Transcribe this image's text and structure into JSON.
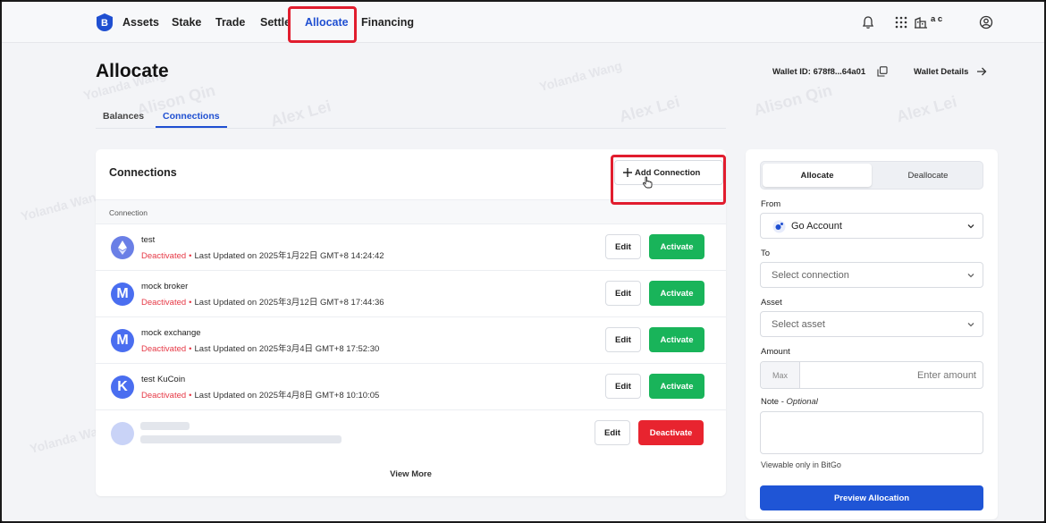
{
  "nav": {
    "items": [
      {
        "label": "Assets"
      },
      {
        "label": "Stake"
      },
      {
        "label": "Trade"
      },
      {
        "label": "Settle"
      },
      {
        "label": "Allocate"
      },
      {
        "label": "Financing"
      }
    ],
    "active": "Allocate",
    "org": "a c"
  },
  "page": {
    "title": "Allocate",
    "wallet_id": "Wallet ID: 678f8...64a01",
    "wallet_details": "Wallet Details"
  },
  "tabs": [
    {
      "label": "Balances"
    },
    {
      "label": "Connections"
    }
  ],
  "connections": {
    "title": "Connections",
    "add_label": "Add Connection",
    "column_header": "Connection",
    "edit_label": "Edit",
    "activate_label": "Activate",
    "deactivate_label": "Deactivate",
    "separator": "•",
    "rows": [
      {
        "initial": "",
        "icon": "ethereum-icon",
        "name": "test",
        "status": "Deactivated",
        "updated": "Last Updated on 2025年1月22日 GMT+8 14:24:42"
      },
      {
        "initial": "M",
        "name": "mock broker",
        "status": "Deactivated",
        "updated": "Last Updated on 2025年3月12日 GMT+8 17:44:36"
      },
      {
        "initial": "M",
        "name": "mock exchange",
        "status": "Deactivated",
        "updated": "Last Updated on 2025年3月4日 GMT+8 17:52:30"
      },
      {
        "initial": "K",
        "name": "test KuCoin",
        "status": "Deactivated",
        "updated": "Last Updated on 2025年4月8日 GMT+8 10:10:05"
      }
    ],
    "view_more": "View More"
  },
  "allocate_panel": {
    "segments": [
      {
        "label": "Allocate"
      },
      {
        "label": "Deallocate"
      }
    ],
    "from_label": "From",
    "from_value": "Go Account",
    "to_label": "To",
    "to_placeholder": "Select connection",
    "asset_label": "Asset",
    "asset_placeholder": "Select asset",
    "amount_label": "Amount",
    "max_label": "Max",
    "amount_placeholder": "Enter amount",
    "note_label": "Note - ",
    "note_optional": "Optional",
    "viewable": "Viewable only in BitGo",
    "preview_label": "Preview Allocation"
  },
  "colors": {
    "accent": "#1f4fd1",
    "activate": "#19b45a",
    "deactivate": "#e8242f",
    "deactivated_text": "#e63946",
    "highlight": "#e11d2e"
  },
  "watermark": [
    "Alex Lei",
    "Alison Qin",
    "Yolanda Wang"
  ]
}
